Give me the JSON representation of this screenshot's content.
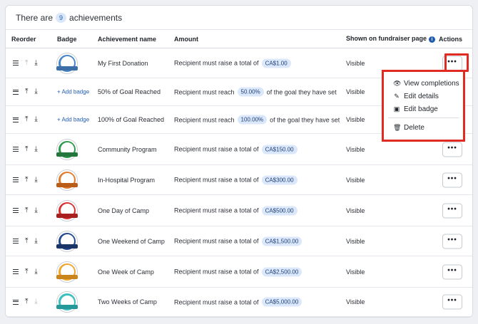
{
  "summary": {
    "prefix": "There are",
    "count": "9",
    "suffix": "achievements"
  },
  "columns": {
    "reorder": "Reorder",
    "badge": "Badge",
    "name": "Achievement name",
    "amount": "Amount",
    "shown": "Shown on fundraiser page",
    "actions": "Actions"
  },
  "add_badge_label": "+ Add badge",
  "rows": [
    {
      "name": "My First Donation",
      "amount_prefix": "Recipient must raise a total of",
      "amount_value": "CA$1.00",
      "amount_suffix": "",
      "shown": "Visible",
      "badge": "medal",
      "badge_color": "#4a86c5",
      "ribbon_color": "#3c6fa8"
    },
    {
      "name": "50% of Goal Reached",
      "amount_prefix": "Recipient must reach",
      "amount_value": "50.00%",
      "amount_suffix": "of the goal they have set",
      "shown": "Visible",
      "badge": "add"
    },
    {
      "name": "100% of Goal Reached",
      "amount_prefix": "Recipient must reach",
      "amount_value": "100.00%",
      "amount_suffix": "of the goal they have set",
      "shown": "Visible",
      "badge": "add"
    },
    {
      "name": "Community Program",
      "amount_prefix": "Recipient must raise a total of",
      "amount_value": "CA$150.00",
      "amount_suffix": "",
      "shown": "Visible",
      "badge": "medal",
      "badge_color": "#2e9a4e",
      "ribbon_color": "#23763c"
    },
    {
      "name": "In-Hospital Program",
      "amount_prefix": "Recipient must raise a total of",
      "amount_value": "CA$300.00",
      "amount_suffix": "",
      "shown": "Visible",
      "badge": "medal",
      "badge_color": "#e07b2b",
      "ribbon_color": "#b95c17"
    },
    {
      "name": "One Day of Camp",
      "amount_prefix": "Recipient must raise a total of",
      "amount_value": "CA$500.00",
      "amount_suffix": "",
      "shown": "Visible",
      "badge": "medal",
      "badge_color": "#d9312f",
      "ribbon_color": "#a8201e"
    },
    {
      "name": "One Weekend of Camp",
      "amount_prefix": "Recipient must raise a total of",
      "amount_value": "CA$1,500.00",
      "amount_suffix": "",
      "shown": "Visible",
      "badge": "medal",
      "badge_color": "#24498f",
      "ribbon_color": "#183468"
    },
    {
      "name": "One Week of Camp",
      "amount_prefix": "Recipient must raise a total of",
      "amount_value": "CA$2,500.00",
      "amount_suffix": "",
      "shown": "Visible",
      "badge": "medal",
      "badge_color": "#f0a52a",
      "ribbon_color": "#c9851a"
    },
    {
      "name": "Two Weeks of Camp",
      "amount_prefix": "Recipient must raise a total of",
      "amount_value": "CA$5,000.00",
      "amount_suffix": "",
      "shown": "Visible",
      "badge": "medal",
      "badge_color": "#3bbfc0",
      "ribbon_color": "#25999a"
    }
  ],
  "actions_menu": {
    "view_completions": "View completions",
    "edit_details": "Edit details",
    "edit_badge": "Edit badge",
    "delete": "Delete"
  },
  "colors": {
    "highlight": "#e02a22",
    "accent": "#1f5bb5",
    "pill_bg": "#dbe8fb"
  }
}
